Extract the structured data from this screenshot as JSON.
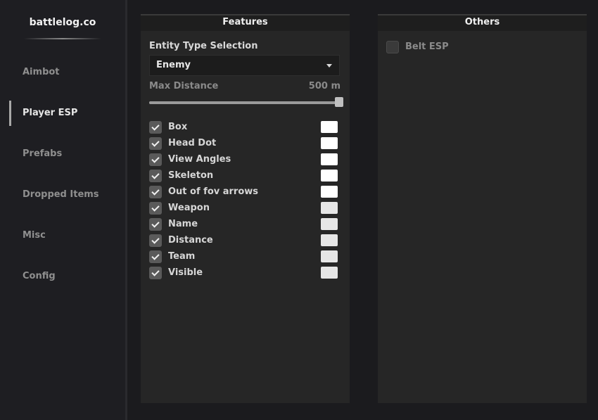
{
  "brand": "battlelog.co",
  "nav": [
    {
      "label": "Aimbot",
      "active": false
    },
    {
      "label": "Player ESP",
      "active": true
    },
    {
      "label": "Prefabs",
      "active": false
    },
    {
      "label": "Dropped Items",
      "active": false
    },
    {
      "label": "Misc",
      "active": false
    },
    {
      "label": "Config",
      "active": false
    }
  ],
  "features": {
    "title": "Features",
    "entity_label": "Entity Type Selection",
    "entity_value": "Enemy",
    "distance_label": "Max Distance",
    "distance_value": "500 m",
    "distance_fraction": 1.0,
    "items": [
      {
        "label": "Box",
        "checked": true,
        "color": "#ffffff"
      },
      {
        "label": "Head Dot",
        "checked": true,
        "color": "#ffffff"
      },
      {
        "label": "View Angles",
        "checked": true,
        "color": "#ffffff"
      },
      {
        "label": "Skeleton",
        "checked": true,
        "color": "#ffffff"
      },
      {
        "label": "Out of fov arrows",
        "checked": true,
        "color": "#ffffff"
      },
      {
        "label": "Weapon",
        "checked": true,
        "color": "#e6e6e6"
      },
      {
        "label": "Name",
        "checked": true,
        "color": "#e6e6e6"
      },
      {
        "label": "Distance",
        "checked": true,
        "color": "#e6e6e6"
      },
      {
        "label": "Team",
        "checked": true,
        "color": "#e6e6e6"
      },
      {
        "label": "Visible",
        "checked": true,
        "color": "#e6e6e6"
      }
    ]
  },
  "others": {
    "title": "Others",
    "belt_label": "Belt ESP",
    "belt_checked": false
  }
}
